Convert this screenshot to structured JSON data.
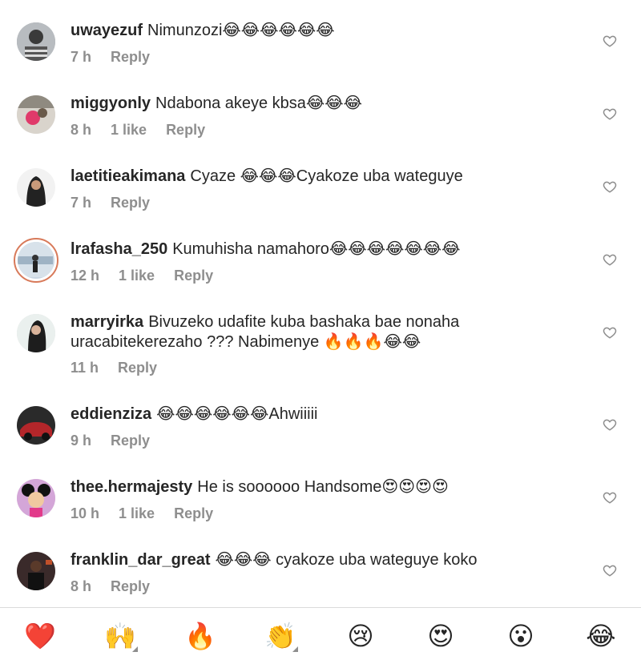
{
  "comments": [
    {
      "username": "uwayezuf",
      "text": "Nimunzozi😂😂😂😂😂😂",
      "time": "7 h",
      "likes": "",
      "reply": "Reply"
    },
    {
      "username": "miggyonly",
      "text": "Ndabona akeye kbsa😂😂😂",
      "time": "8 h",
      "likes": "1 like",
      "reply": "Reply"
    },
    {
      "username": "laetitieakimana",
      "text": "Cyaze 😂😂😂Cyakoze uba wateguye",
      "time": "7 h",
      "likes": "",
      "reply": "Reply"
    },
    {
      "username": "lrafasha_250",
      "text": "Kumuhisha namahoro😂😂😂😂😂😂😂",
      "time": "12 h",
      "likes": "1 like",
      "reply": "Reply"
    },
    {
      "username": "marryirka",
      "text": "Bivuzeko udafite kuba bashaka bae nonaha uracabitekerezaho ??? Nabimenye 🔥🔥🔥😂😂",
      "time": "11 h",
      "likes": "",
      "reply": "Reply"
    },
    {
      "username": "eddienziza",
      "text": "😂😂😂😂😂😂Ahwiiiii",
      "time": "9 h",
      "likes": "",
      "reply": "Reply"
    },
    {
      "username": "thee.hermajesty",
      "text": "He is soooooo Handsome😍😍😍😍",
      "time": "10 h",
      "likes": "1 like",
      "reply": "Reply"
    },
    {
      "username": "franklin_dar_great",
      "text": "😂😂😂 cyakoze uba wateguye koko",
      "time": "8 h",
      "likes": "",
      "reply": "Reply"
    }
  ],
  "reactions": [
    {
      "name": "red-heart",
      "glyph": "❤️",
      "has_menu": false
    },
    {
      "name": "raising-hands",
      "glyph": "🙌",
      "has_menu": true
    },
    {
      "name": "fire",
      "glyph": "🔥",
      "has_menu": false
    },
    {
      "name": "clapping-hands",
      "glyph": "👏",
      "has_menu": true
    },
    {
      "name": "crying-face",
      "glyph": "😢",
      "has_menu": false
    },
    {
      "name": "heart-eyes",
      "glyph": "😍",
      "has_menu": false
    },
    {
      "name": "surprised-face",
      "glyph": "😮",
      "has_menu": false
    },
    {
      "name": "tears-of-joy",
      "glyph": "😂",
      "has_menu": false
    }
  ],
  "colors": {
    "text": "#262626",
    "meta": "#8e8e8e",
    "story_ring": "#d87a5a"
  }
}
